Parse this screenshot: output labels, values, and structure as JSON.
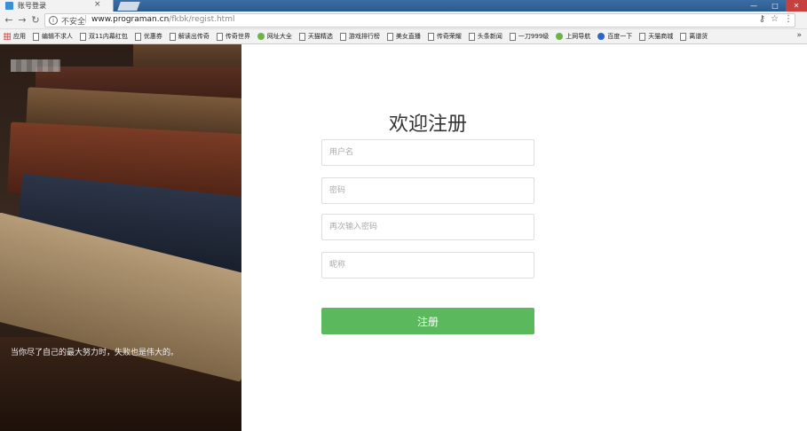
{
  "browser": {
    "tab_title": "账号登录",
    "tab_close": "×",
    "security_label": "不安全",
    "url_separator": "|",
    "url_host": "www.programan.cn",
    "url_path": "/fkbk/regist.html",
    "window_minimize": "—",
    "window_maximize": "□",
    "window_close": "✕"
  },
  "bookmarks": [
    {
      "label": "应用",
      "icon": "apps-icon"
    },
    {
      "label": "编辑不求人",
      "icon": "page-icon"
    },
    {
      "label": "双11内幕红包",
      "icon": "page-icon"
    },
    {
      "label": "优惠券",
      "icon": "page-icon"
    },
    {
      "label": "解读出传奇",
      "icon": "page-icon"
    },
    {
      "label": "传奇世界",
      "icon": "page-icon"
    },
    {
      "label": "网址大全",
      "icon": "green-icon"
    },
    {
      "label": "天猫精选",
      "icon": "page-icon"
    },
    {
      "label": "游戏排行榜",
      "icon": "page-icon"
    },
    {
      "label": "美女直播",
      "icon": "page-icon"
    },
    {
      "label": "传奇荣耀",
      "icon": "page-icon"
    },
    {
      "label": "头条新闻",
      "icon": "page-icon"
    },
    {
      "label": "一刀999级",
      "icon": "page-icon"
    },
    {
      "label": "上网导航",
      "icon": "green-icon"
    },
    {
      "label": "百度一下",
      "icon": "paw-icon"
    },
    {
      "label": "天猫商城",
      "icon": "page-icon"
    },
    {
      "label": "离谱货",
      "icon": "page-icon"
    }
  ],
  "bookmarks_more": "»",
  "page": {
    "slogan": "当你尽了自己的最大努力时，失败也是伟大的。",
    "title": "欢迎注册",
    "username_placeholder": "用户名",
    "password_placeholder": "密码",
    "confirm_placeholder": "再次输入密码",
    "nickname_placeholder": "昵称",
    "submit_label": "注册"
  },
  "colors": {
    "accent_green": "#5cb85c",
    "tab_bar": "#3a6ea5"
  }
}
